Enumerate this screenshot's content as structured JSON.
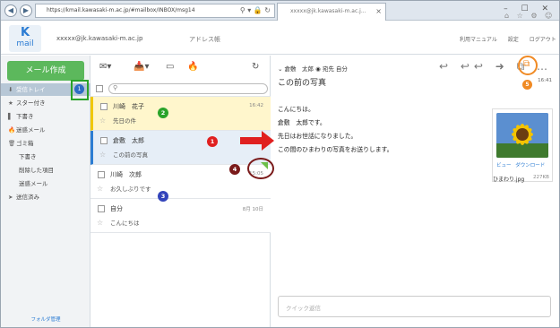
{
  "browser": {
    "url": "https://kmail.kawasaki-m.ac.jp/#mailbox/INBOX/msg14",
    "tab_title": "xxxxx@jk.kawasaki-m.ac.j...",
    "tab_close": "×",
    "back": "◀",
    "forward": "▶",
    "addr_icons": "⚲ ▾ 🔒 ↻",
    "window_controls": "– ☐ ✕",
    "toolbar_icons": "⌂ ☆ ⚙ ☺"
  },
  "header": {
    "logo_k": "K",
    "logo_mail": "mail",
    "user": "xxxxx@jk.kawasaki-m.ac.jp",
    "addressbook": "アドレス帳",
    "links": [
      "利用マニュアル",
      "設定",
      "ログアウト"
    ]
  },
  "sidebar": {
    "compose": "メール作成",
    "folders": [
      {
        "icon": "⬇",
        "label": "受信トレイ"
      },
      {
        "icon": "★",
        "label": "スター付き"
      },
      {
        "icon": "▌",
        "label": "下書き"
      },
      {
        "icon": "🔥",
        "label": "迷惑メール"
      },
      {
        "icon": "🗑",
        "label": "ゴミ箱"
      },
      {
        "icon": "",
        "label": "下書き"
      },
      {
        "icon": "",
        "label": "削除した項目"
      },
      {
        "icon": "",
        "label": "迷惑メール"
      },
      {
        "icon": "➤",
        "label": "送信済み"
      }
    ],
    "inbox_badge": "1",
    "folder_mgmt": "フォルダ管理"
  },
  "list": {
    "toolbar": [
      "✉▾",
      "📥▾",
      "▭",
      "🔥",
      "↻"
    ],
    "search_icon": "⚲",
    "messages": [
      {
        "sender": "川崎　花子",
        "subject": "先日の件",
        "time": "16:42",
        "bg": "#fff6cc",
        "accent": "#f0c800"
      },
      {
        "sender": "倉敷　太郎",
        "subject": "この前の写真",
        "time": "",
        "bg": "#e6eef7",
        "accent": "#2b7cd3"
      },
      {
        "sender": "川崎　次郎",
        "subject": "お久しぶりです",
        "time": "15:05",
        "bg": "#ffffff",
        "accent": ""
      },
      {
        "sender": "自分",
        "subject": "こんにちは",
        "time": "8月 10日",
        "bg": "#ffffff",
        "accent": ""
      }
    ]
  },
  "reader": {
    "from": "⌄ 倉敷　太郎 ◉ 宛先 自分",
    "subject": "この前の写真",
    "time": "16:41",
    "actions": "↩ ↩↩ ➜ ⧉ …",
    "popout_icon": "⧉",
    "body_lines": [
      "こんにちは。",
      "倉敷　太郎です。",
      "先日はお世話になりました。",
      "この間のひまわりの写真をお送りします。"
    ],
    "attachment": {
      "name": "ひまわり.jpg",
      "size": "227KB",
      "view": "ビュー",
      "download": "ダウンロード"
    },
    "reply_placeholder": "クイック返信"
  },
  "annotations": {
    "n1": "1",
    "n2": "2",
    "n3": "3",
    "n4": "4",
    "n5": "5"
  }
}
